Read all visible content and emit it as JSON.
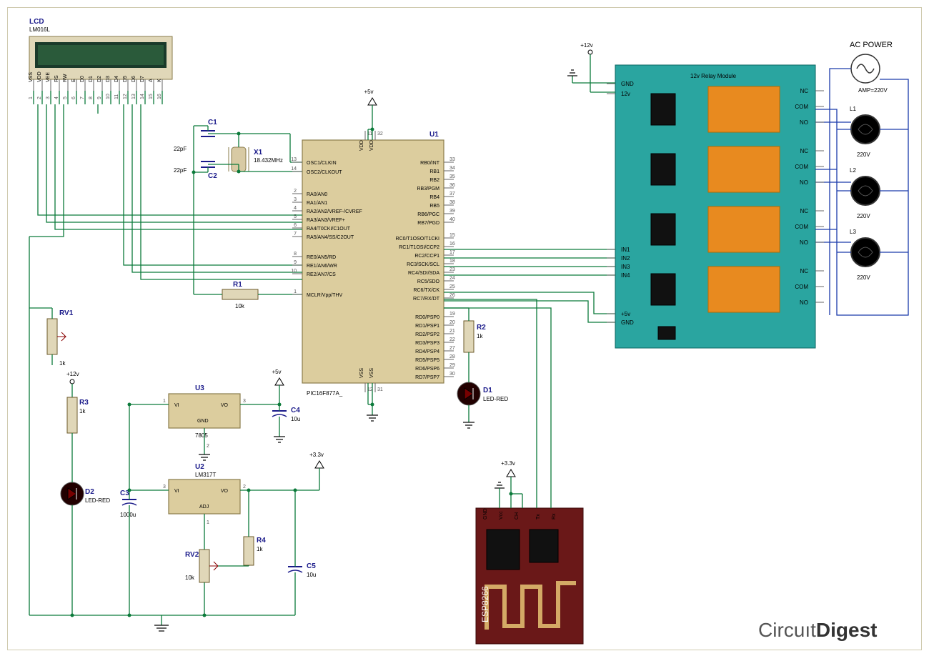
{
  "lcd": {
    "ref": "LCD",
    "val": "LM016L",
    "pins": [
      "VSS",
      "VDD",
      "VEE",
      "RS",
      "RW",
      "E",
      "D0",
      "D1",
      "D2",
      "D3",
      "D4",
      "D5",
      "D6",
      "D7",
      "A",
      "K"
    ],
    "pin_nums": [
      "1",
      "2",
      "3",
      "4",
      "5",
      "6",
      "7",
      "8",
      "9",
      "10",
      "11",
      "12",
      "13",
      "14",
      "15",
      "16"
    ]
  },
  "mcu": {
    "ref": "U1",
    "val": "PIC16F877A_",
    "left_pins": [
      {
        "num": "13",
        "name": "OSC1/CLKIN"
      },
      {
        "num": "14",
        "name": "OSC2/CLKOUT"
      },
      {
        "num": "2",
        "name": "RA0/AN0"
      },
      {
        "num": "3",
        "name": "RA1/AN1"
      },
      {
        "num": "4",
        "name": "RA2/AN2/VREF-/CVREF"
      },
      {
        "num": "5",
        "name": "RA3/AN3/VREF+"
      },
      {
        "num": "6",
        "name": "RA4/T0CKI/C1OUT"
      },
      {
        "num": "7",
        "name": "RA5/AN4/SS/C2OUT"
      },
      {
        "num": "8",
        "name": "RE0/AN5/RD"
      },
      {
        "num": "9",
        "name": "RE1/AN6/WR"
      },
      {
        "num": "10",
        "name": "RE2/AN7/CS"
      },
      {
        "num": "1",
        "name": "MCLR/Vpp/THV"
      }
    ],
    "right_pins": [
      {
        "num": "33",
        "name": "RB0/INT"
      },
      {
        "num": "34",
        "name": "RB1"
      },
      {
        "num": "35",
        "name": "RB2"
      },
      {
        "num": "36",
        "name": "RB3/PGM"
      },
      {
        "num": "37",
        "name": "RB4"
      },
      {
        "num": "38",
        "name": "RB5"
      },
      {
        "num": "39",
        "name": "RB6/PGC"
      },
      {
        "num": "40",
        "name": "RB7/PGD"
      },
      {
        "num": "15",
        "name": "RC0/T1OSO/T1CKI"
      },
      {
        "num": "16",
        "name": "RC1/T1OSI/CCP2"
      },
      {
        "num": "17",
        "name": "RC2/CCP1"
      },
      {
        "num": "18",
        "name": "RC3/SCK/SCL"
      },
      {
        "num": "23",
        "name": "RC4/SDI/SDA"
      },
      {
        "num": "24",
        "name": "RC5/SDO"
      },
      {
        "num": "25",
        "name": "RC6/TX/CK"
      },
      {
        "num": "26",
        "name": "RC7/RX/DT"
      },
      {
        "num": "19",
        "name": "RD0/PSP0"
      },
      {
        "num": "20",
        "name": "RD1/PSP1"
      },
      {
        "num": "21",
        "name": "RD2/PSP2"
      },
      {
        "num": "22",
        "name": "RD3/PSP3"
      },
      {
        "num": "27",
        "name": "RD4/PSP4"
      },
      {
        "num": "28",
        "name": "RD5/PSP5"
      },
      {
        "num": "29",
        "name": "RD6/PSP6"
      },
      {
        "num": "30",
        "name": "RD7/PSP7"
      }
    ],
    "top_pins": [
      {
        "num": "11",
        "name": "VDD"
      },
      {
        "num": "32",
        "name": "VDD"
      }
    ],
    "bot_pins": [
      {
        "num": "12",
        "name": "VSS"
      },
      {
        "num": "31",
        "name": "VSS"
      }
    ]
  },
  "u3": {
    "ref": "U3",
    "val": "7805",
    "pins": {
      "vi": "VI",
      "vo": "VO",
      "gnd": "GND",
      "pin_vi": "1",
      "pin_vo": "3",
      "pin_gnd": "2"
    }
  },
  "u2": {
    "ref": "U2",
    "val": "LM317T",
    "pins": {
      "vi": "VI",
      "vo": "VO",
      "adj": "ADJ",
      "pin_vi": "3",
      "pin_vo": "2",
      "pin_adj": "1"
    }
  },
  "crystal": {
    "ref": "X1",
    "val": "18.432MHz"
  },
  "caps": {
    "c1": {
      "ref": "C1",
      "val": "22pF"
    },
    "c2": {
      "ref": "C2",
      "val": "22pF"
    },
    "c3": {
      "ref": "C3",
      "val": "1000u"
    },
    "c4": {
      "ref": "C4",
      "val": "10u"
    },
    "c5": {
      "ref": "C5",
      "val": "10u"
    }
  },
  "resistors": {
    "r1": {
      "ref": "R1",
      "val": "10k"
    },
    "r2": {
      "ref": "R2",
      "val": "1k"
    },
    "r3": {
      "ref": "R3",
      "val": "1k"
    },
    "r4": {
      "ref": "R4",
      "val": "1k"
    },
    "rv1": {
      "ref": "RV1",
      "val": "1k"
    },
    "rv2": {
      "ref": "RV2",
      "val": "10k"
    }
  },
  "leds": {
    "d1": {
      "ref": "D1",
      "val": "LED-RED"
    },
    "d2": {
      "ref": "D2",
      "val": "LED-RED"
    }
  },
  "relay": {
    "title": "12v Relay Module",
    "left_labels": [
      "GND",
      "12v",
      "IN1",
      "IN2",
      "IN3",
      "IN4",
      "+5v",
      "GND"
    ],
    "right_labels": [
      "NC",
      "COM",
      "NO",
      "NC",
      "COM",
      "NO",
      "NC",
      "COM",
      "NO",
      "NC",
      "COM",
      "NO"
    ]
  },
  "power_labels": {
    "p12v": "+12v",
    "p5v": "+5v",
    "p3v3": "+3.3v"
  },
  "ac": {
    "title": "AC POWER",
    "amp": "AMP=220V",
    "loads": [
      "L1",
      "L2",
      "L3"
    ],
    "volt": "220V"
  },
  "esp": {
    "name": "ESP8266",
    "pins": [
      "GND",
      "Vcc",
      "CH",
      "Tx",
      "Rx"
    ]
  },
  "watermark": "CircuitDigest"
}
